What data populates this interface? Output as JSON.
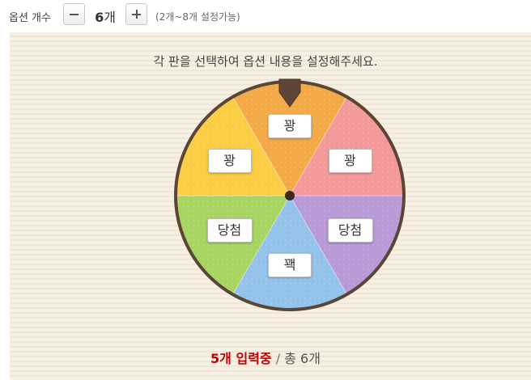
{
  "option_count": {
    "label": "옵션 개수",
    "value": "6",
    "unit": "개",
    "range_hint": "(2개~8개 설정가능)",
    "decrement_icon": "minus-icon",
    "increment_icon": "plus-icon"
  },
  "instruction": "각 판을 선택하여 옵션 내용을 설정해주세요.",
  "wheel": {
    "slices": [
      {
        "label": "꽝",
        "color": "#f4a947"
      },
      {
        "label": "꽝",
        "color": "#f4999a"
      },
      {
        "label": "당첨",
        "color": "#b79ad6"
      },
      {
        "label": "꽥",
        "color": "#93c2ea"
      },
      {
        "label": "당첨",
        "color": "#a8d462"
      },
      {
        "label": "꽝",
        "color": "#fbcd42"
      }
    ],
    "rim_color": "#5b4636",
    "pointer_icon": "pointer-marker-icon"
  },
  "status": {
    "filled": "5개 입력중",
    "separator": "/",
    "total": "총 6개"
  }
}
